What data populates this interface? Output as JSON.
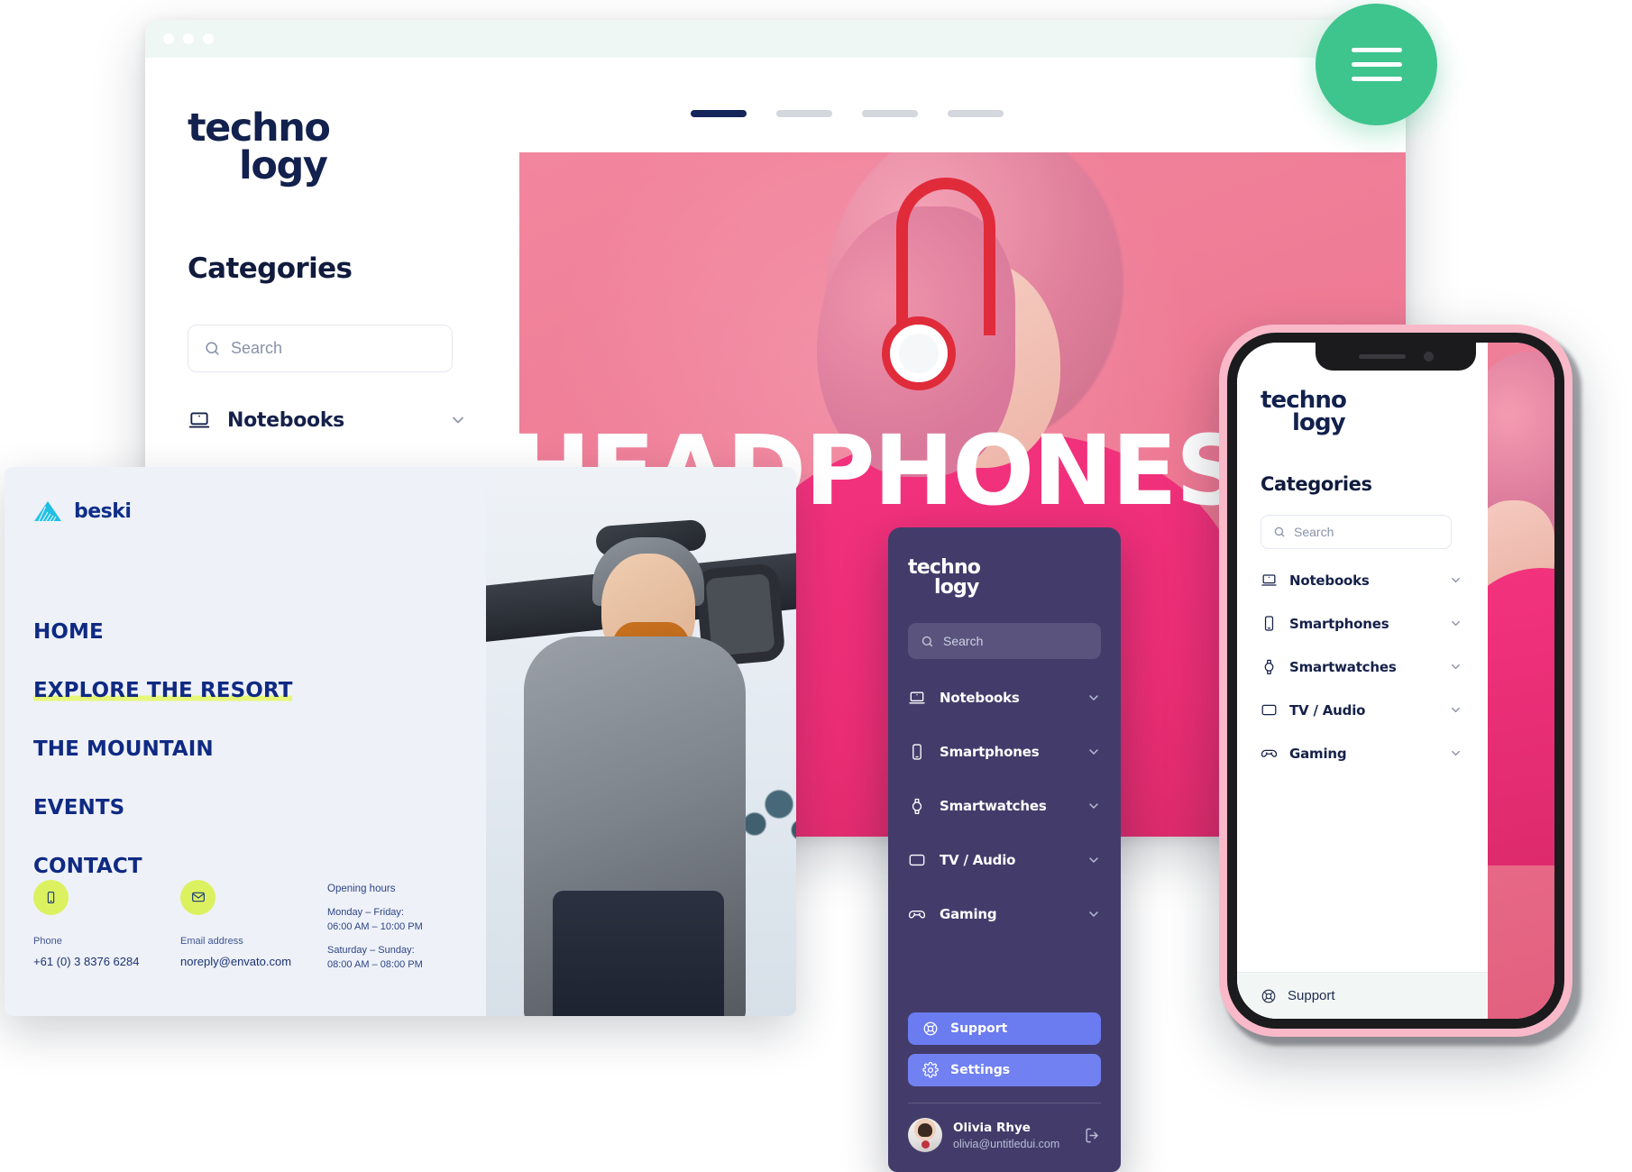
{
  "browser": {
    "window_dots": 3,
    "sidebar": {
      "logo_line1": "techno",
      "logo_line2": "logy",
      "categories_title": "Categories",
      "search_placeholder": "Search",
      "search_value": "",
      "items": [
        {
          "label": "Notebooks",
          "icon": "laptop-icon",
          "chevron": "chevron-down-icon"
        }
      ]
    },
    "hero": {
      "headline": "HEADPHONES",
      "slide_dots": [
        {
          "active": true
        },
        {
          "active": false
        },
        {
          "active": false
        },
        {
          "active": false
        }
      ]
    }
  },
  "fab": {
    "icon": "hamburger-menu-icon",
    "color": "#3ec48d",
    "bars": 3
  },
  "beski": {
    "logo": {
      "name": "beski",
      "icon": "mountain-icon",
      "color": "#0f2f88"
    },
    "nav": [
      {
        "label": "HOME",
        "highlighted": false
      },
      {
        "label": "EXPLORE THE RESORT",
        "highlighted": true
      },
      {
        "label": "THE MOUNTAIN",
        "highlighted": false
      },
      {
        "label": "EVENTS",
        "highlighted": false
      },
      {
        "label": "CONTACT",
        "highlighted": false
      }
    ],
    "highlight_color": "#e7f77a",
    "contacts": [
      {
        "icon": "phone-icon",
        "label": "Phone",
        "value": "+61 (0) 3 8376 6284"
      },
      {
        "icon": "mail-icon",
        "label": "Email address",
        "value": "noreply@envato.com"
      }
    ],
    "hours": {
      "title": "Opening hours",
      "groups": [
        {
          "days": "Monday – Friday:",
          "time": "06:00 AM – 10:00 PM"
        },
        {
          "days": "Saturday – Sunday:",
          "time": "08:00 AM – 08:00 PM"
        }
      ]
    },
    "photo_alt": "snowboarder-photo"
  },
  "dark_sidebar": {
    "logo_line1": "techno",
    "logo_line2": "logy",
    "search_placeholder": "Search",
    "search_value": "",
    "items": [
      {
        "label": "Notebooks",
        "icon": "laptop-icon"
      },
      {
        "label": "Smartphones",
        "icon": "smartphone-icon"
      },
      {
        "label": "Smartwatches",
        "icon": "smartwatch-icon"
      },
      {
        "label": "TV / Audio",
        "icon": "tv-icon"
      },
      {
        "label": "Gaming",
        "icon": "gamepad-icon"
      }
    ],
    "actions": [
      {
        "label": "Support",
        "icon": "lifebuoy-icon"
      },
      {
        "label": "Settings",
        "icon": "gear-icon"
      }
    ],
    "user": {
      "name": "Olivia Rhye",
      "email": "olivia@untitledui.com",
      "logout_icon": "logout-icon",
      "avatar": "user-avatar"
    },
    "bg_color": "#433c6b",
    "button_color": "#6b7bf0"
  },
  "phone": {
    "frame_color": "#f9b9c9",
    "logo_line1": "techno",
    "logo_line2": "logy",
    "categories_title": "Categories",
    "search_placeholder": "Search",
    "search_value": "",
    "items": [
      {
        "label": "Notebooks",
        "icon": "laptop-icon"
      },
      {
        "label": "Smartphones",
        "icon": "smartphone-icon"
      },
      {
        "label": "Smartwatches",
        "icon": "smartwatch-icon"
      },
      {
        "label": "TV / Audio",
        "icon": "tv-icon"
      },
      {
        "label": "Gaming",
        "icon": "gamepad-icon"
      }
    ],
    "support_label": "Support",
    "support_icon": "lifebuoy-icon"
  }
}
